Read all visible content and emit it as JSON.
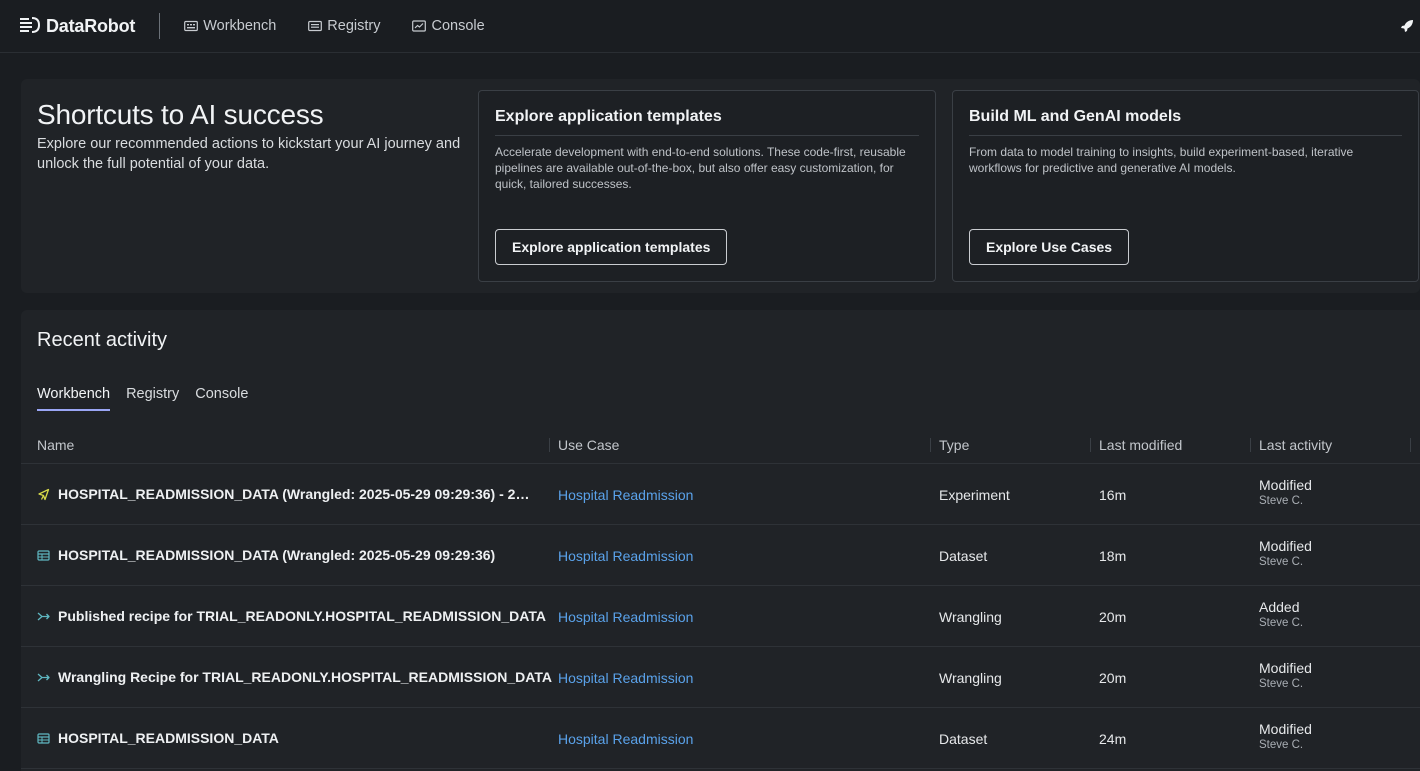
{
  "app": {
    "name": "DataRobot"
  },
  "nav": [
    {
      "label": "Workbench",
      "icon": "workbench-icon"
    },
    {
      "label": "Registry",
      "icon": "registry-icon"
    },
    {
      "label": "Console",
      "icon": "console-icon"
    }
  ],
  "shortcuts": {
    "title": "Shortcuts to AI success",
    "subtitle": "Explore our recommended actions to kickstart your AI journey and unlock the full potential of your data.",
    "cards": [
      {
        "title": "Explore application templates",
        "text": "Accelerate development with end-to-end solutions. These code-first, reusable pipelines are available out-of-the-box, but also offer easy customization, for quick, tailored successes.",
        "button": "Explore application templates"
      },
      {
        "title": "Build ML and GenAI models",
        "text": "From data to model training to insights, build experiment-based, iterative workflows for predictive and generative AI models.",
        "button": "Explore Use Cases"
      }
    ]
  },
  "recent": {
    "title": "Recent activity",
    "tabs": [
      "Workbench",
      "Registry",
      "Console"
    ],
    "active_tab": "Workbench",
    "columns": [
      "Name",
      "Use Case",
      "Type",
      "Last modified",
      "Last activity"
    ],
    "rows": [
      {
        "icon": "experiment-icon",
        "name": "HOSPITAL_READMISSION_DATA (Wrangled: 2025-05-29 09:29:36) - 2…",
        "use_case": "Hospital Readmission",
        "type": "Experiment",
        "modified": "16m",
        "activity": "Modified",
        "user": "Steve C."
      },
      {
        "icon": "dataset-icon",
        "name": "HOSPITAL_READMISSION_DATA (Wrangled: 2025-05-29 09:29:36)",
        "use_case": "Hospital Readmission",
        "type": "Dataset",
        "modified": "18m",
        "activity": "Modified",
        "user": "Steve C."
      },
      {
        "icon": "wrangling-icon",
        "name": "Published recipe for TRIAL_READONLY.HOSPITAL_READMISSION_DATA",
        "use_case": "Hospital Readmission",
        "type": "Wrangling",
        "modified": "20m",
        "activity": "Added",
        "user": "Steve C."
      },
      {
        "icon": "wrangling-icon",
        "name": "Wrangling Recipe for TRIAL_READONLY.HOSPITAL_READMISSION_DATA",
        "use_case": "Hospital Readmission",
        "type": "Wrangling",
        "modified": "20m",
        "activity": "Modified",
        "user": "Steve C."
      },
      {
        "icon": "dataset-icon",
        "name": "HOSPITAL_READMISSION_DATA",
        "use_case": "Hospital Readmission",
        "type": "Dataset",
        "modified": "24m",
        "activity": "Modified",
        "user": "Steve C."
      }
    ]
  },
  "colors": {
    "accent_tab": "#9aa6f5",
    "link": "#5aa2ea",
    "experiment": "#d7d94a",
    "dataset": "#5fb8c2"
  }
}
